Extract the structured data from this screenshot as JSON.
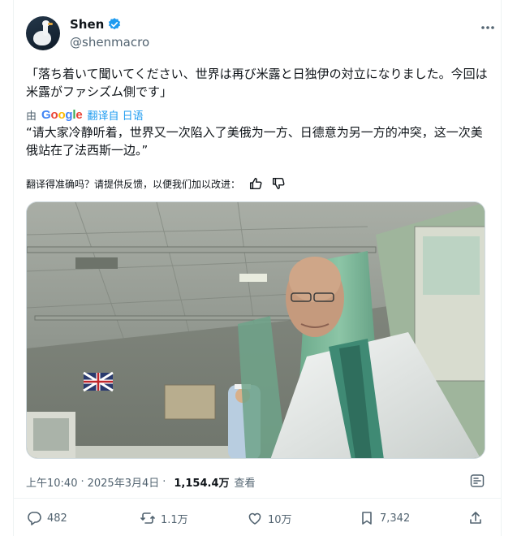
{
  "author": {
    "display_name": "Shen",
    "handle": "@shenmacro"
  },
  "tweet": {
    "original_text": "「落ち着いて聞いてください、世界は再び米露と日独伊の対立になりました。今回は米露がファシズム側です」",
    "translated_prefix": "由",
    "translator_logo": "Google",
    "translate_link": "翻译自 日语",
    "translated_text": "“请大家冷静听着，世界又一次陷入了美俄为一方、日德意为另一方的冲突，这一次美俄站在了法西斯一边。”",
    "feedback_prompt": "翻译得准确吗？请提供反馈，以便我们加以改进："
  },
  "meta": {
    "time": "上午10:40",
    "separator": "·",
    "date": "2025年3月4日",
    "views": "1,154.4万",
    "views_label": "查看"
  },
  "actions": {
    "replies": "482",
    "reposts": "1.1万",
    "likes": "10万",
    "bookmarks": "7,342"
  },
  "colors": {
    "accent": "#1d9bf0",
    "secondary_text": "#536471",
    "primary_text": "#0f1419",
    "border": "#eff3f4"
  },
  "icons": [
    "more-icon",
    "verified-badge-icon",
    "thumbs-up-icon",
    "thumbs-down-icon",
    "grok-icon",
    "reply-icon",
    "repost-icon",
    "like-icon",
    "bookmark-icon",
    "share-icon"
  ]
}
